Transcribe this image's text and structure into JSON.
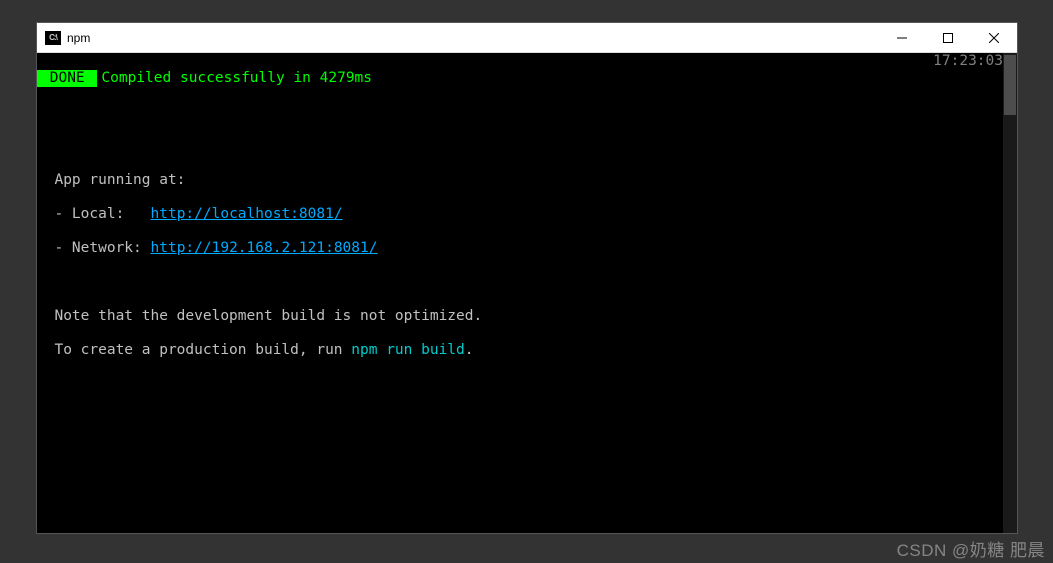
{
  "titlebar": {
    "icon_label": "C:\\",
    "title": "npm"
  },
  "terminal": {
    "done_badge": " DONE ",
    "compiled": "Compiled successfully in 4279ms",
    "timestamp": "17:23:03",
    "app_running": "  App running at:",
    "local_label": "  - Local:   ",
    "local_url": "http://localhost:8081/",
    "network_label": "  - Network: ",
    "network_url": "http://192.168.2.121:8081/",
    "note1": "  Note that the development build is not optimized.",
    "note2_prefix": "  To create a production build, run ",
    "note2_cmd": "npm run build",
    "note2_suffix": "."
  },
  "watermark": "CSDN @奶糖 肥晨"
}
